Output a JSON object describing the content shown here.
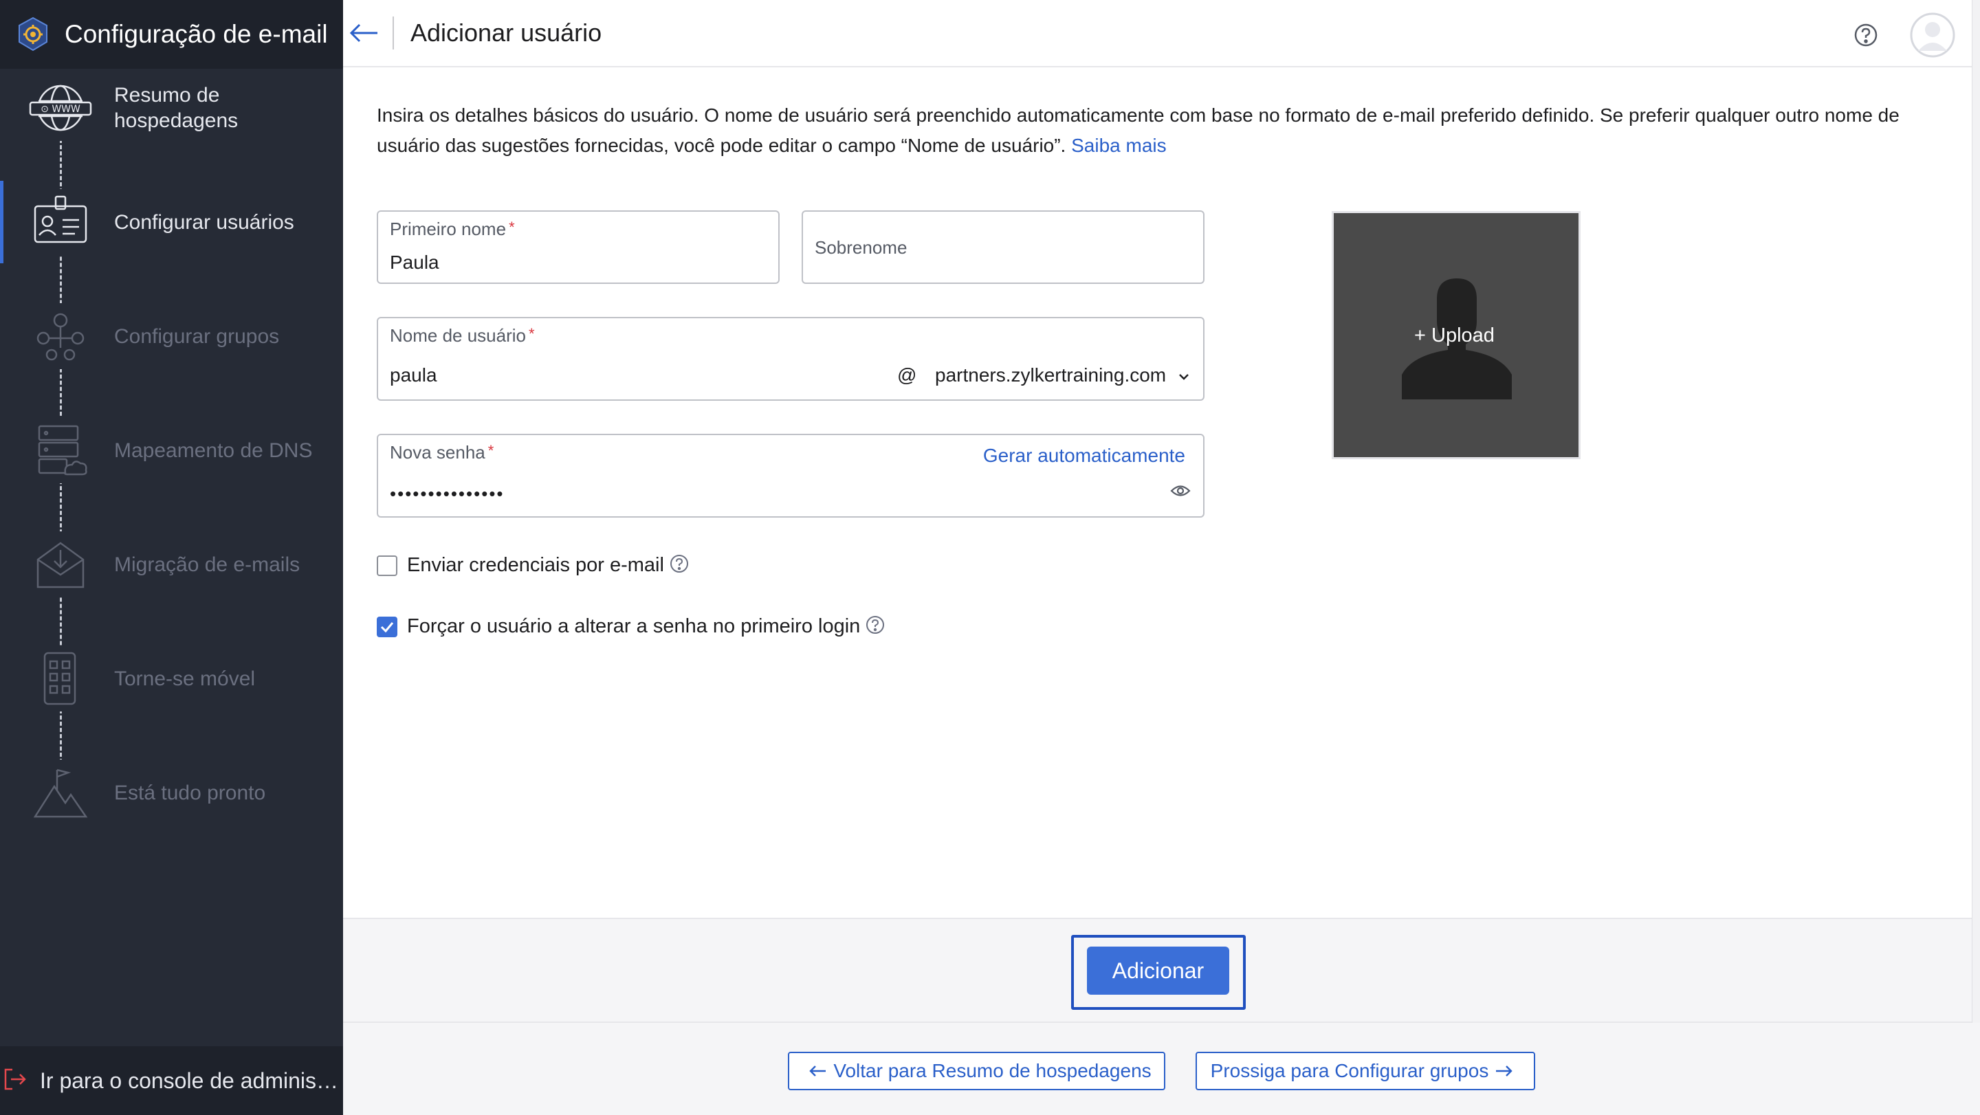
{
  "sidebar": {
    "title": "Configuração de e-mail",
    "items": [
      {
        "label": "Resumo de hospedagens",
        "state": "done",
        "icon": "globe-www-icon"
      },
      {
        "label": "Configurar usuários",
        "state": "active",
        "icon": "user-card-icon"
      },
      {
        "label": "Configurar grupos",
        "state": "pending",
        "icon": "group-network-icon"
      },
      {
        "label": "Mapeamento de DNS",
        "state": "pending",
        "icon": "dns-server-icon"
      },
      {
        "label": "Migração de e-mails",
        "state": "pending",
        "icon": "mail-download-icon"
      },
      {
        "label": "Torne-se móvel",
        "state": "pending",
        "icon": "mobile-apps-icon"
      },
      {
        "label": "Está tudo pronto",
        "state": "pending",
        "icon": "mountain-flag-icon"
      }
    ],
    "footer_label": "Ir para o console de administração"
  },
  "header": {
    "title": "Adicionar usuário"
  },
  "intro": {
    "text": "Insira os detalhes básicos do usuário. O nome de usuário será preenchido automaticamente com base no formato de e-mail preferido definido. Se preferir qualquer outro nome de usuário das sugestões fornecidas, você pode editar o campo “Nome de usuário”.",
    "link": "Saiba mais"
  },
  "form": {
    "first_name": {
      "label": "Primeiro nome",
      "value": "Paula",
      "required": "*"
    },
    "last_name": {
      "label": "Sobrenome",
      "value": ""
    },
    "username": {
      "label": "Nome de usuário",
      "value": "paula",
      "required": "*",
      "at": "@",
      "domain": "partners.zylkertraining.com"
    },
    "password": {
      "label": "Nova senha",
      "value": "•••••••••••••••",
      "required": "*",
      "autogen": "Gerar automaticamente"
    },
    "upload_label": "Upload",
    "send_credentials": {
      "label": "Enviar credenciais por e-mail",
      "checked": false
    },
    "force_change": {
      "label": "Forçar o usuário a alterar a senha no primeiro login",
      "checked": true
    }
  },
  "actions": {
    "add_label": "Adicionar",
    "prev_label": "Voltar para Resumo de hospedagens",
    "next_label": "Prossiga para Configurar grupos"
  },
  "colors": {
    "sidebar_bg": "#262b36",
    "accent": "#3b6fd8",
    "link": "#2a5fc9",
    "required": "#d9363e"
  }
}
